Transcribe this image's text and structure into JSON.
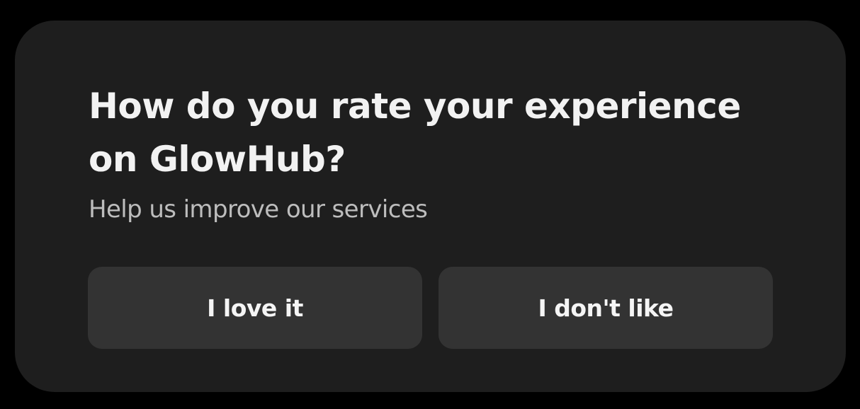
{
  "dialog": {
    "title": "How do you rate your experience on GlowHub?",
    "subtitle": "Help us improve our services",
    "buttons": {
      "love_label": "I love it",
      "dislike_label": "I don't like"
    }
  },
  "colors": {
    "background": "#000000",
    "card": "#1e1e1e",
    "button": "#333333",
    "title_text": "#f2f2f2",
    "subtitle_text": "#bdbdbd"
  }
}
